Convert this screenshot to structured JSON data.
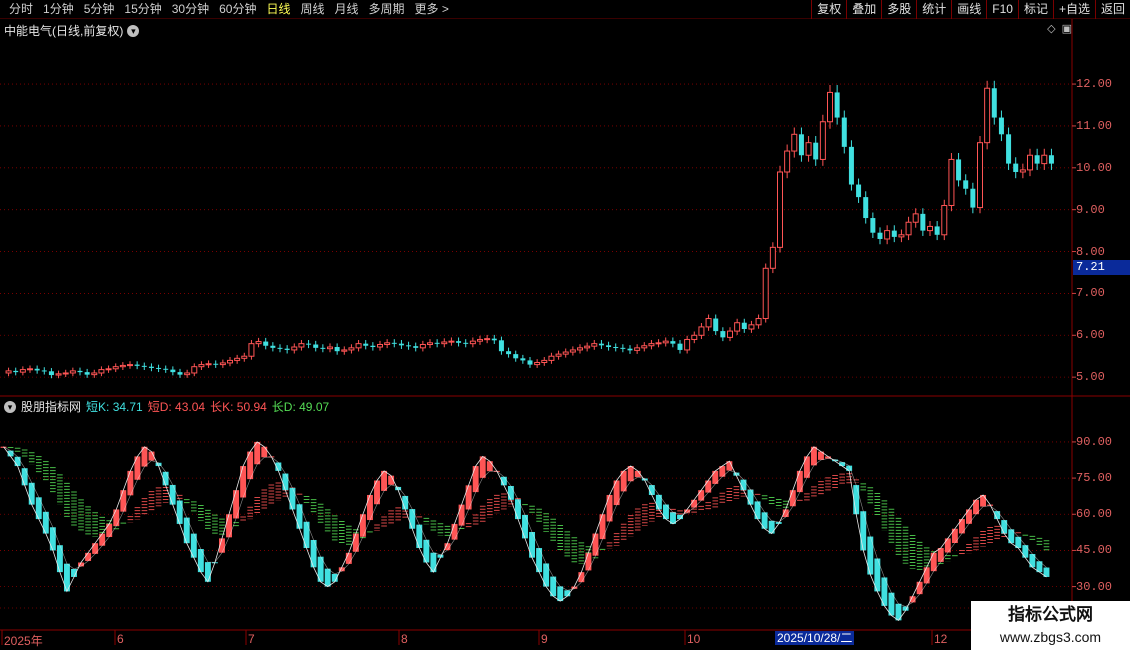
{
  "toolbar": {
    "periods": [
      "分时",
      "1分钟",
      "5分钟",
      "15分钟",
      "30分钟",
      "60分钟",
      "日线",
      "周线",
      "月线",
      "多周期",
      "更多 >"
    ],
    "active_period": "日线",
    "right_buttons": [
      "复权",
      "叠加",
      "多股",
      "统计",
      "画线",
      "F10",
      "标记",
      "+自选",
      "返回"
    ]
  },
  "stock": {
    "title": "中能电气(日线,前复权)",
    "current_price": "7.21"
  },
  "indicator": {
    "name": "股朋指标网",
    "values": [
      {
        "label": "短K: 34.71",
        "color": "#40e0e0"
      },
      {
        "label": "短D: 43.04",
        "color": "#ff5555"
      },
      {
        "label": "长K: 50.94",
        "color": "#ff5555"
      },
      {
        "label": "长D: 49.07",
        "color": "#55dd55"
      }
    ]
  },
  "price_axis": [
    "12.00",
    "11.00",
    "10.00",
    "9.00",
    "8.00",
    "7.00",
    "6.00",
    "5.00"
  ],
  "indicator_axis": [
    "90.00",
    "75.00",
    "60.00",
    "45.00",
    "30.00"
  ],
  "x_axis": [
    "2025年",
    "6",
    "7",
    "8",
    "9",
    "10",
    "12"
  ],
  "cursor_date": "2025/10/28/二",
  "watermark": {
    "line1": "指标公式网",
    "line2": "www.zbgs3.com"
  },
  "colors": {
    "up": "#ff5555",
    "down": "#40e0e0",
    "grid": "#8a0000",
    "long_d": "#55dd55"
  },
  "chart_data": {
    "type": "candlestick",
    "open": [
      5.1,
      5.15,
      5.12,
      5.18,
      5.2,
      5.16,
      5.14,
      5.05,
      5.08,
      5.1,
      5.15,
      5.12,
      5.06,
      5.1,
      5.18,
      5.2,
      5.25,
      5.28,
      5.3,
      5.27,
      5.25,
      5.22,
      5.2,
      5.18,
      5.12,
      5.06,
      5.1,
      5.25,
      5.3,
      5.32,
      5.3,
      5.34,
      5.4,
      5.45,
      5.5,
      5.8,
      5.85,
      5.75,
      5.7,
      5.68,
      5.65,
      5.72,
      5.8,
      5.78,
      5.7,
      5.68,
      5.72,
      5.62,
      5.65,
      5.7,
      5.8,
      5.75,
      5.72,
      5.78,
      5.82,
      5.8,
      5.76,
      5.74,
      5.7,
      5.78,
      5.82,
      5.8,
      5.84,
      5.86,
      5.82,
      5.8,
      5.86,
      5.9,
      5.92,
      5.88,
      5.62,
      5.55,
      5.45,
      5.4,
      5.3,
      5.35,
      5.4,
      5.5,
      5.55,
      5.6,
      5.65,
      5.7,
      5.74,
      5.8,
      5.76,
      5.72,
      5.7,
      5.68,
      5.64,
      5.7,
      5.75,
      5.8,
      5.82,
      5.86,
      5.8,
      5.65,
      5.9,
      6.0,
      6.2,
      6.4,
      6.1,
      5.95,
      6.1,
      6.3,
      6.15,
      6.25,
      6.4,
      7.6,
      8.1,
      9.9,
      10.4,
      10.8,
      10.3,
      10.6,
      10.2,
      11.1,
      11.8,
      11.2,
      10.5,
      9.6,
      9.3,
      8.8,
      8.45,
      8.3,
      8.5,
      8.35,
      8.4,
      8.7,
      8.9,
      8.5,
      8.6,
      8.4,
      9.1,
      10.2,
      9.7,
      9.5,
      9.05,
      10.6,
      11.9,
      11.2,
      10.8,
      10.1,
      9.9,
      9.95,
      10.3,
      10.1,
      10.3
    ],
    "close": [
      5.15,
      5.12,
      5.18,
      5.2,
      5.16,
      5.14,
      5.05,
      5.08,
      5.1,
      5.15,
      5.12,
      5.06,
      5.1,
      5.18,
      5.2,
      5.25,
      5.28,
      5.3,
      5.27,
      5.25,
      5.22,
      5.2,
      5.18,
      5.12,
      5.06,
      5.1,
      5.25,
      5.3,
      5.32,
      5.3,
      5.34,
      5.4,
      5.45,
      5.5,
      5.8,
      5.85,
      5.75,
      5.7,
      5.68,
      5.65,
      5.72,
      5.8,
      5.78,
      5.7,
      5.68,
      5.72,
      5.62,
      5.65,
      5.7,
      5.8,
      5.75,
      5.72,
      5.78,
      5.82,
      5.8,
      5.76,
      5.74,
      5.7,
      5.78,
      5.82,
      5.8,
      5.84,
      5.86,
      5.82,
      5.8,
      5.86,
      5.9,
      5.92,
      5.88,
      5.62,
      5.55,
      5.45,
      5.4,
      5.3,
      5.35,
      5.4,
      5.5,
      5.55,
      5.6,
      5.65,
      5.7,
      5.74,
      5.8,
      5.76,
      5.72,
      5.7,
      5.68,
      5.64,
      5.7,
      5.75,
      5.8,
      5.82,
      5.86,
      5.8,
      5.65,
      5.9,
      6.0,
      6.2,
      6.4,
      6.1,
      5.95,
      6.1,
      6.3,
      6.15,
      6.25,
      6.4,
      7.6,
      8.1,
      9.9,
      10.4,
      10.8,
      10.3,
      10.6,
      10.2,
      11.1,
      11.8,
      11.2,
      10.5,
      9.6,
      9.3,
      8.8,
      8.45,
      8.3,
      8.5,
      8.35,
      8.4,
      8.7,
      8.9,
      8.5,
      8.6,
      8.4,
      9.1,
      10.2,
      9.7,
      9.5,
      9.05,
      10.6,
      11.9,
      11.2,
      10.8,
      10.1,
      9.9,
      9.95,
      10.3,
      10.1,
      10.3,
      10.1
    ],
    "y_range": [
      4.55,
      13.1
    ],
    "indicator_range": [
      12,
      102
    ],
    "short_k": [
      88,
      84,
      80,
      72,
      64,
      58,
      52,
      45,
      36,
      28,
      34,
      40,
      44,
      48,
      52,
      56,
      62,
      70,
      78,
      84,
      88,
      86,
      80,
      72,
      64,
      56,
      48,
      42,
      36,
      32,
      40,
      50,
      60,
      70,
      80,
      86,
      90,
      88,
      84,
      78,
      70,
      62,
      54,
      46,
      38,
      32,
      30,
      32,
      38,
      44,
      52,
      60,
      68,
      74,
      78,
      76,
      70,
      62,
      54,
      46,
      40,
      36,
      42,
      48,
      56,
      64,
      72,
      80,
      84,
      82,
      78,
      72,
      66,
      58,
      50,
      42,
      36,
      30,
      26,
      24,
      26,
      30,
      36,
      44,
      52,
      60,
      68,
      74,
      78,
      80,
      78,
      74,
      68,
      62,
      58,
      56,
      58,
      62,
      66,
      70,
      74,
      78,
      80,
      82,
      76,
      70,
      64,
      58,
      54,
      52,
      56,
      62,
      70,
      78,
      84,
      88,
      86,
      84,
      82,
      80,
      78,
      60,
      45,
      35,
      28,
      22,
      18,
      16,
      20,
      26,
      32,
      38,
      44,
      46,
      50,
      54,
      58,
      62,
      66,
      68,
      64,
      58,
      52,
      48,
      46,
      42,
      38,
      36,
      34
    ]
  }
}
